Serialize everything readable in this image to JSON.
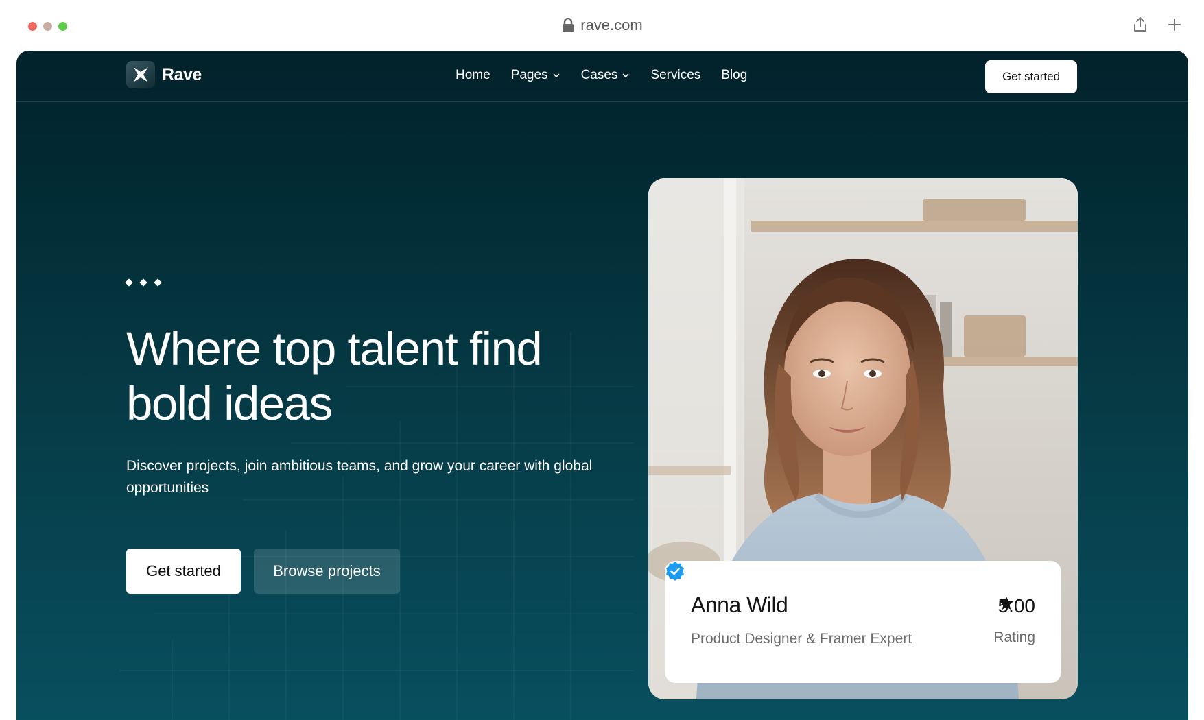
{
  "browser": {
    "url": "rave.com",
    "icons": [
      "lock-icon",
      "share-icon",
      "new-tab-icon"
    ]
  },
  "nav": {
    "brand": "Rave",
    "links": [
      {
        "label": "Home",
        "has_dropdown": false
      },
      {
        "label": "Pages",
        "has_dropdown": true
      },
      {
        "label": "Cases",
        "has_dropdown": true
      },
      {
        "label": "Services",
        "has_dropdown": false
      },
      {
        "label": "Blog",
        "has_dropdown": false
      }
    ],
    "cta": "Get started"
  },
  "hero": {
    "title_line1": "Where top talent find",
    "title_line2": "bold ideas",
    "subtitle": "Discover projects, join ambitious teams, and grow your career with global opportunities",
    "primary_button": "Get started",
    "secondary_button": "Browse projects"
  },
  "profile": {
    "name": "Anna Wild",
    "role": "Product Designer & Framer Expert",
    "rating": "5.00",
    "rating_label": "Rating"
  },
  "colors": {
    "bg_top": "#03222b",
    "bg_bottom": "#085060",
    "accent_verified": "#1d9bf0"
  }
}
